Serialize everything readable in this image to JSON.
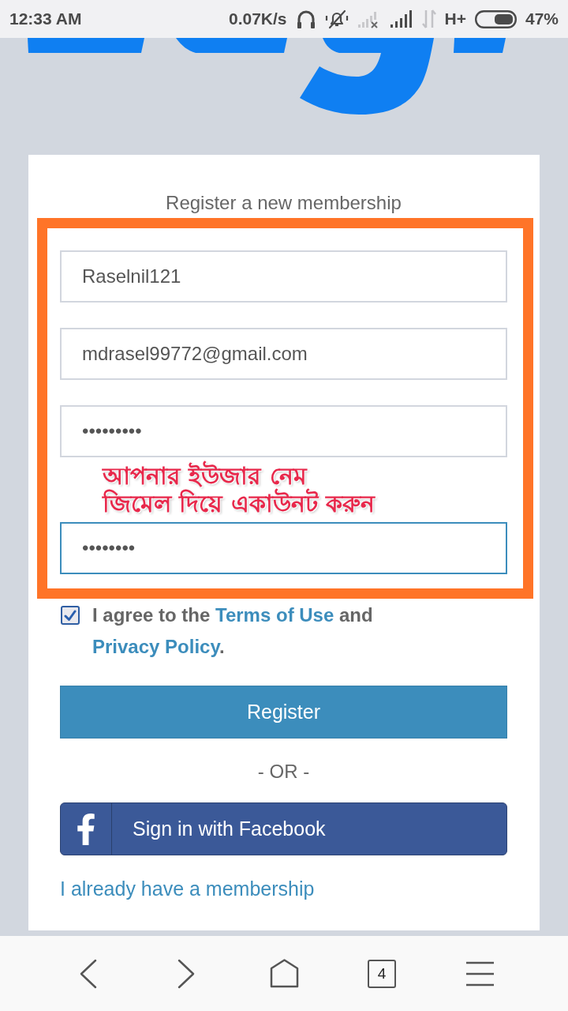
{
  "status_bar": {
    "time": "12:33 AM",
    "net_speed": "0.07K/s",
    "network_type": "H+",
    "battery": "47%"
  },
  "form": {
    "title": "Register a new membership",
    "fields": [
      {
        "value": "Raselnil121",
        "focused": false
      },
      {
        "value": "mdrasel99772@gmail.com",
        "focused": false
      },
      {
        "value": "•••••••••",
        "focused": false
      },
      {
        "value": "••••••••",
        "focused": true
      }
    ],
    "annotation": [
      "আপনার ইউজার নেম",
      "জিমেল দিয়ে একাউনট করুন"
    ],
    "agreement": {
      "checked": true,
      "parts": [
        {
          "kind": "text",
          "text": "I agree to the "
        },
        {
          "kind": "link",
          "text": "Terms of Use"
        },
        {
          "kind": "text",
          "text": " and "
        },
        {
          "kind": "link",
          "text": "Privacy Policy"
        },
        {
          "kind": "text",
          "text": "."
        }
      ]
    },
    "register_button": "Register",
    "separator": "- OR -",
    "facebook_button": "Sign in with Facebook",
    "login_link": "I already have a membership"
  },
  "browser_nav": {
    "tab_count": "4"
  }
}
